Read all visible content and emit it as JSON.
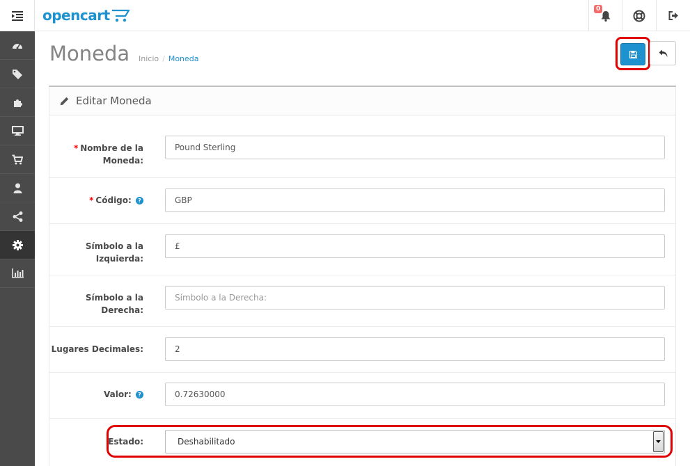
{
  "app": {
    "logo_text": "opencart"
  },
  "header": {
    "notification_count": "0"
  },
  "sidebar": {
    "items": [
      {
        "icon": "dashboard-icon",
        "active": false
      },
      {
        "icon": "tags-icon",
        "active": false
      },
      {
        "icon": "puzzle-icon",
        "active": false
      },
      {
        "icon": "desktop-icon",
        "active": false
      },
      {
        "icon": "cart-icon",
        "active": false
      },
      {
        "icon": "user-icon",
        "active": false
      },
      {
        "icon": "share-icon",
        "active": false
      },
      {
        "icon": "cog-icon",
        "active": true
      },
      {
        "icon": "bar-chart-icon",
        "active": false
      }
    ]
  },
  "page": {
    "title": "Moneda",
    "breadcrumb": {
      "home": "Inicio",
      "separator": "/",
      "current": "Moneda"
    }
  },
  "panel": {
    "title": "Editar Moneda"
  },
  "form": {
    "name": {
      "label_line1": "Nombre de la",
      "label_line2": "Moneda:",
      "value": "Pound Sterling",
      "required_mark": "*"
    },
    "code": {
      "label": "Código:",
      "value": "GBP",
      "required_mark": "*",
      "help_mark": "?"
    },
    "symbol_left": {
      "label_line1": "Símbolo a la",
      "label_line2": "Izquierda:",
      "value": "£"
    },
    "symbol_right": {
      "label_line1": "Símbolo a la",
      "label_line2": "Derecha:",
      "value": "",
      "placeholder": "Símbolo a la Derecha:"
    },
    "decimal_place": {
      "label": "Lugares Decimales:",
      "value": "2"
    },
    "value": {
      "label": "Valor:",
      "value": "0.72630000",
      "help_mark": "?"
    },
    "status": {
      "label": "Estado:",
      "selected": "Deshabilitado"
    }
  },
  "colors": {
    "brand": "#1e91cf",
    "highlight": "#e10000",
    "sidebar": "#4a4a4a"
  }
}
